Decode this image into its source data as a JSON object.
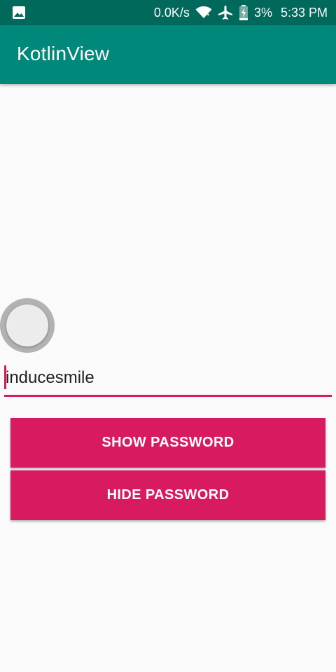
{
  "status_bar": {
    "network_speed": "0.0K/s",
    "battery_percent": "3%",
    "time": "5:33 PM",
    "icons": [
      "gallery-icon",
      "wifi-icon",
      "airplane-icon",
      "battery-charging-icon"
    ]
  },
  "app_bar": {
    "title": "KotlinView"
  },
  "form": {
    "password_value": "inducesmile",
    "show_button": "SHOW PASSWORD",
    "hide_button": "HIDE PASSWORD"
  },
  "colors": {
    "status_bar": "#00695c",
    "app_bar": "#00897b",
    "accent": "#d81b60",
    "background": "#fafafa"
  }
}
